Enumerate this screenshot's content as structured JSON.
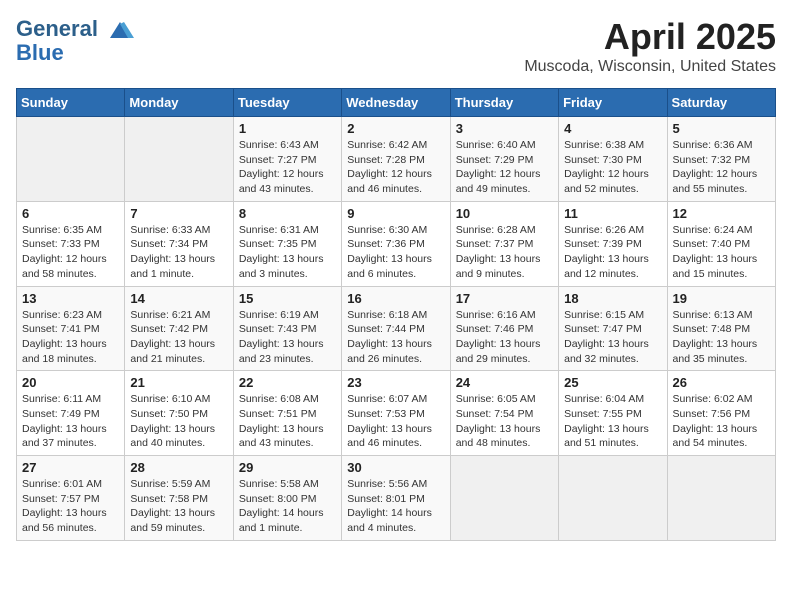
{
  "header": {
    "logo_line1": "General",
    "logo_line2": "Blue",
    "month": "April 2025",
    "location": "Muscoda, Wisconsin, United States"
  },
  "weekdays": [
    "Sunday",
    "Monday",
    "Tuesday",
    "Wednesday",
    "Thursday",
    "Friday",
    "Saturday"
  ],
  "weeks": [
    [
      {
        "day": "",
        "info": ""
      },
      {
        "day": "",
        "info": ""
      },
      {
        "day": "1",
        "info": "Sunrise: 6:43 AM\nSunset: 7:27 PM\nDaylight: 12 hours\nand 43 minutes."
      },
      {
        "day": "2",
        "info": "Sunrise: 6:42 AM\nSunset: 7:28 PM\nDaylight: 12 hours\nand 46 minutes."
      },
      {
        "day": "3",
        "info": "Sunrise: 6:40 AM\nSunset: 7:29 PM\nDaylight: 12 hours\nand 49 minutes."
      },
      {
        "day": "4",
        "info": "Sunrise: 6:38 AM\nSunset: 7:30 PM\nDaylight: 12 hours\nand 52 minutes."
      },
      {
        "day": "5",
        "info": "Sunrise: 6:36 AM\nSunset: 7:32 PM\nDaylight: 12 hours\nand 55 minutes."
      }
    ],
    [
      {
        "day": "6",
        "info": "Sunrise: 6:35 AM\nSunset: 7:33 PM\nDaylight: 12 hours\nand 58 minutes."
      },
      {
        "day": "7",
        "info": "Sunrise: 6:33 AM\nSunset: 7:34 PM\nDaylight: 13 hours\nand 1 minute."
      },
      {
        "day": "8",
        "info": "Sunrise: 6:31 AM\nSunset: 7:35 PM\nDaylight: 13 hours\nand 3 minutes."
      },
      {
        "day": "9",
        "info": "Sunrise: 6:30 AM\nSunset: 7:36 PM\nDaylight: 13 hours\nand 6 minutes."
      },
      {
        "day": "10",
        "info": "Sunrise: 6:28 AM\nSunset: 7:37 PM\nDaylight: 13 hours\nand 9 minutes."
      },
      {
        "day": "11",
        "info": "Sunrise: 6:26 AM\nSunset: 7:39 PM\nDaylight: 13 hours\nand 12 minutes."
      },
      {
        "day": "12",
        "info": "Sunrise: 6:24 AM\nSunset: 7:40 PM\nDaylight: 13 hours\nand 15 minutes."
      }
    ],
    [
      {
        "day": "13",
        "info": "Sunrise: 6:23 AM\nSunset: 7:41 PM\nDaylight: 13 hours\nand 18 minutes."
      },
      {
        "day": "14",
        "info": "Sunrise: 6:21 AM\nSunset: 7:42 PM\nDaylight: 13 hours\nand 21 minutes."
      },
      {
        "day": "15",
        "info": "Sunrise: 6:19 AM\nSunset: 7:43 PM\nDaylight: 13 hours\nand 23 minutes."
      },
      {
        "day": "16",
        "info": "Sunrise: 6:18 AM\nSunset: 7:44 PM\nDaylight: 13 hours\nand 26 minutes."
      },
      {
        "day": "17",
        "info": "Sunrise: 6:16 AM\nSunset: 7:46 PM\nDaylight: 13 hours\nand 29 minutes."
      },
      {
        "day": "18",
        "info": "Sunrise: 6:15 AM\nSunset: 7:47 PM\nDaylight: 13 hours\nand 32 minutes."
      },
      {
        "day": "19",
        "info": "Sunrise: 6:13 AM\nSunset: 7:48 PM\nDaylight: 13 hours\nand 35 minutes."
      }
    ],
    [
      {
        "day": "20",
        "info": "Sunrise: 6:11 AM\nSunset: 7:49 PM\nDaylight: 13 hours\nand 37 minutes."
      },
      {
        "day": "21",
        "info": "Sunrise: 6:10 AM\nSunset: 7:50 PM\nDaylight: 13 hours\nand 40 minutes."
      },
      {
        "day": "22",
        "info": "Sunrise: 6:08 AM\nSunset: 7:51 PM\nDaylight: 13 hours\nand 43 minutes."
      },
      {
        "day": "23",
        "info": "Sunrise: 6:07 AM\nSunset: 7:53 PM\nDaylight: 13 hours\nand 46 minutes."
      },
      {
        "day": "24",
        "info": "Sunrise: 6:05 AM\nSunset: 7:54 PM\nDaylight: 13 hours\nand 48 minutes."
      },
      {
        "day": "25",
        "info": "Sunrise: 6:04 AM\nSunset: 7:55 PM\nDaylight: 13 hours\nand 51 minutes."
      },
      {
        "day": "26",
        "info": "Sunrise: 6:02 AM\nSunset: 7:56 PM\nDaylight: 13 hours\nand 54 minutes."
      }
    ],
    [
      {
        "day": "27",
        "info": "Sunrise: 6:01 AM\nSunset: 7:57 PM\nDaylight: 13 hours\nand 56 minutes."
      },
      {
        "day": "28",
        "info": "Sunrise: 5:59 AM\nSunset: 7:58 PM\nDaylight: 13 hours\nand 59 minutes."
      },
      {
        "day": "29",
        "info": "Sunrise: 5:58 AM\nSunset: 8:00 PM\nDaylight: 14 hours\nand 1 minute."
      },
      {
        "day": "30",
        "info": "Sunrise: 5:56 AM\nSunset: 8:01 PM\nDaylight: 14 hours\nand 4 minutes."
      },
      {
        "day": "",
        "info": ""
      },
      {
        "day": "",
        "info": ""
      },
      {
        "day": "",
        "info": ""
      }
    ]
  ]
}
